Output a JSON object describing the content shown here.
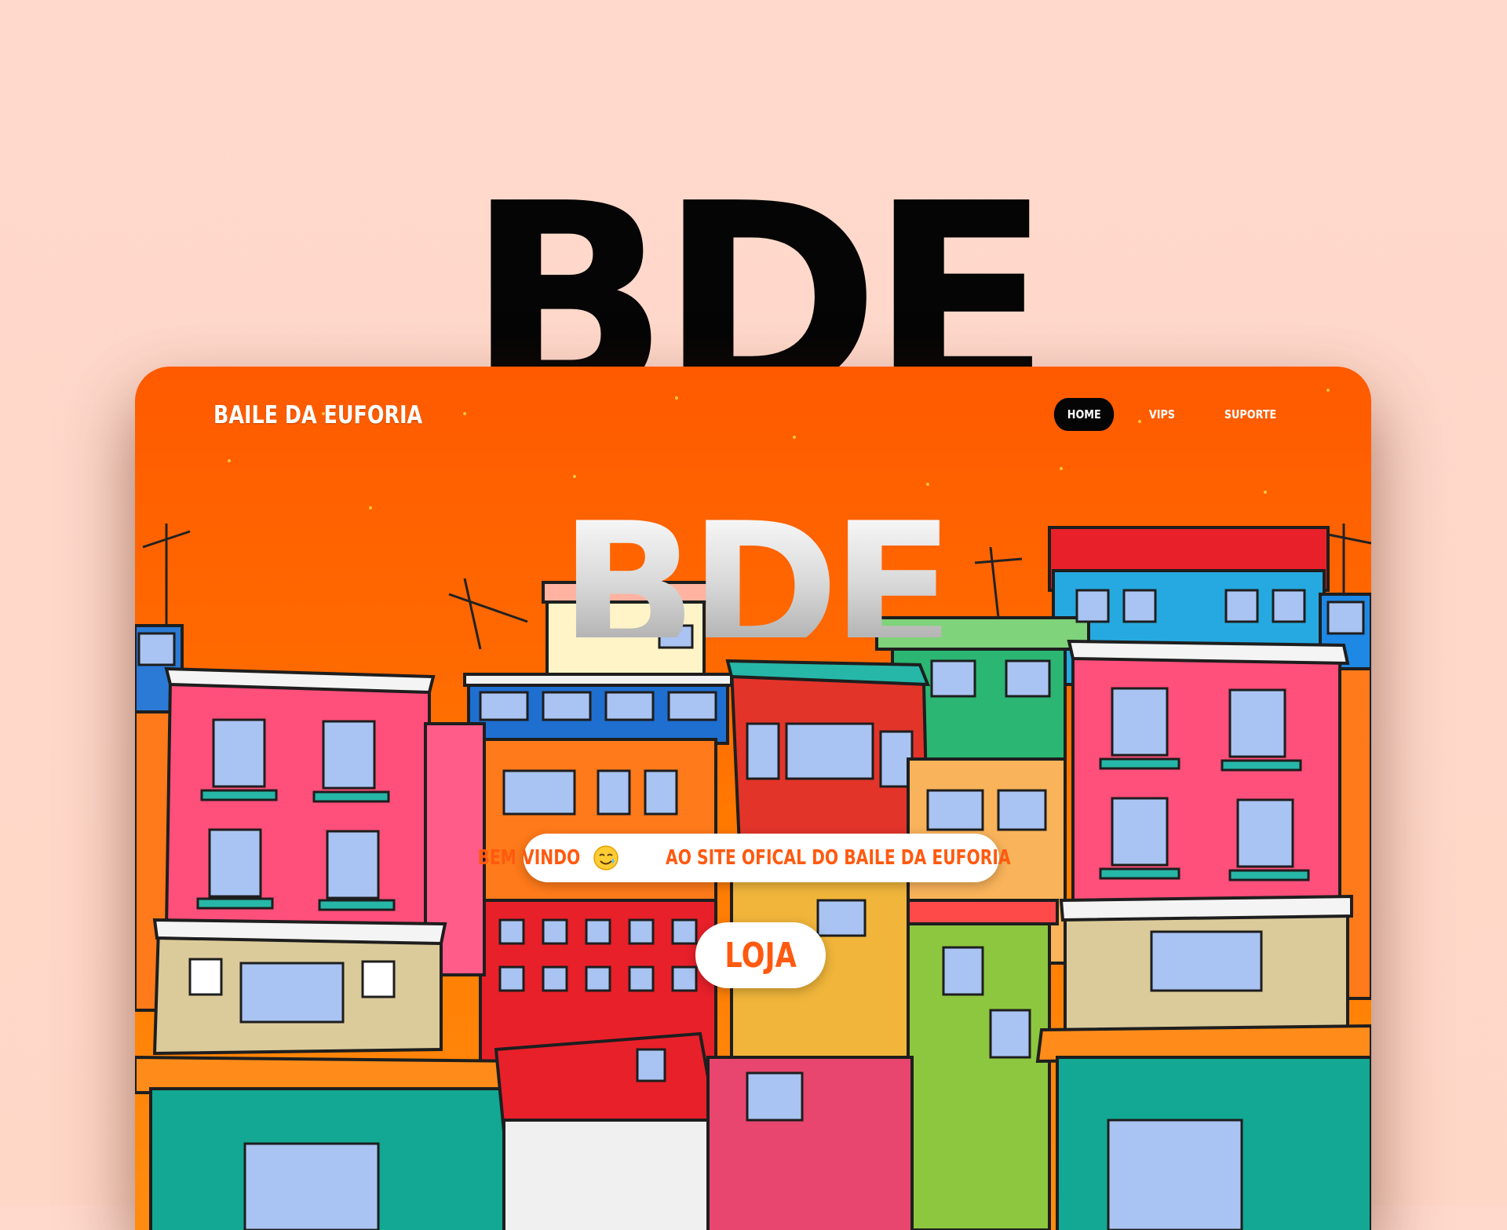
{
  "showcase": {
    "title": "BDE"
  },
  "site": {
    "brand": "BAILE DA EUFORIA",
    "nav": [
      {
        "label": "HOME",
        "active": true
      },
      {
        "label": "VIPS",
        "active": false
      },
      {
        "label": "SUPORTE",
        "active": false
      }
    ],
    "hero_title": "BDE",
    "welcome_before": "BEM VINDO",
    "welcome_after": "AO SITE OFICAL DO BAILE DA EUFORIA",
    "welcome_icon": "smiling-face-with-tear-emoji",
    "cta_label": "LOJA"
  },
  "colors": {
    "page_bg": "#ffd9cc",
    "hero_orange": "#ff5a00",
    "accent_text": "#ff5a10",
    "nav_active_bg": "#050505"
  }
}
